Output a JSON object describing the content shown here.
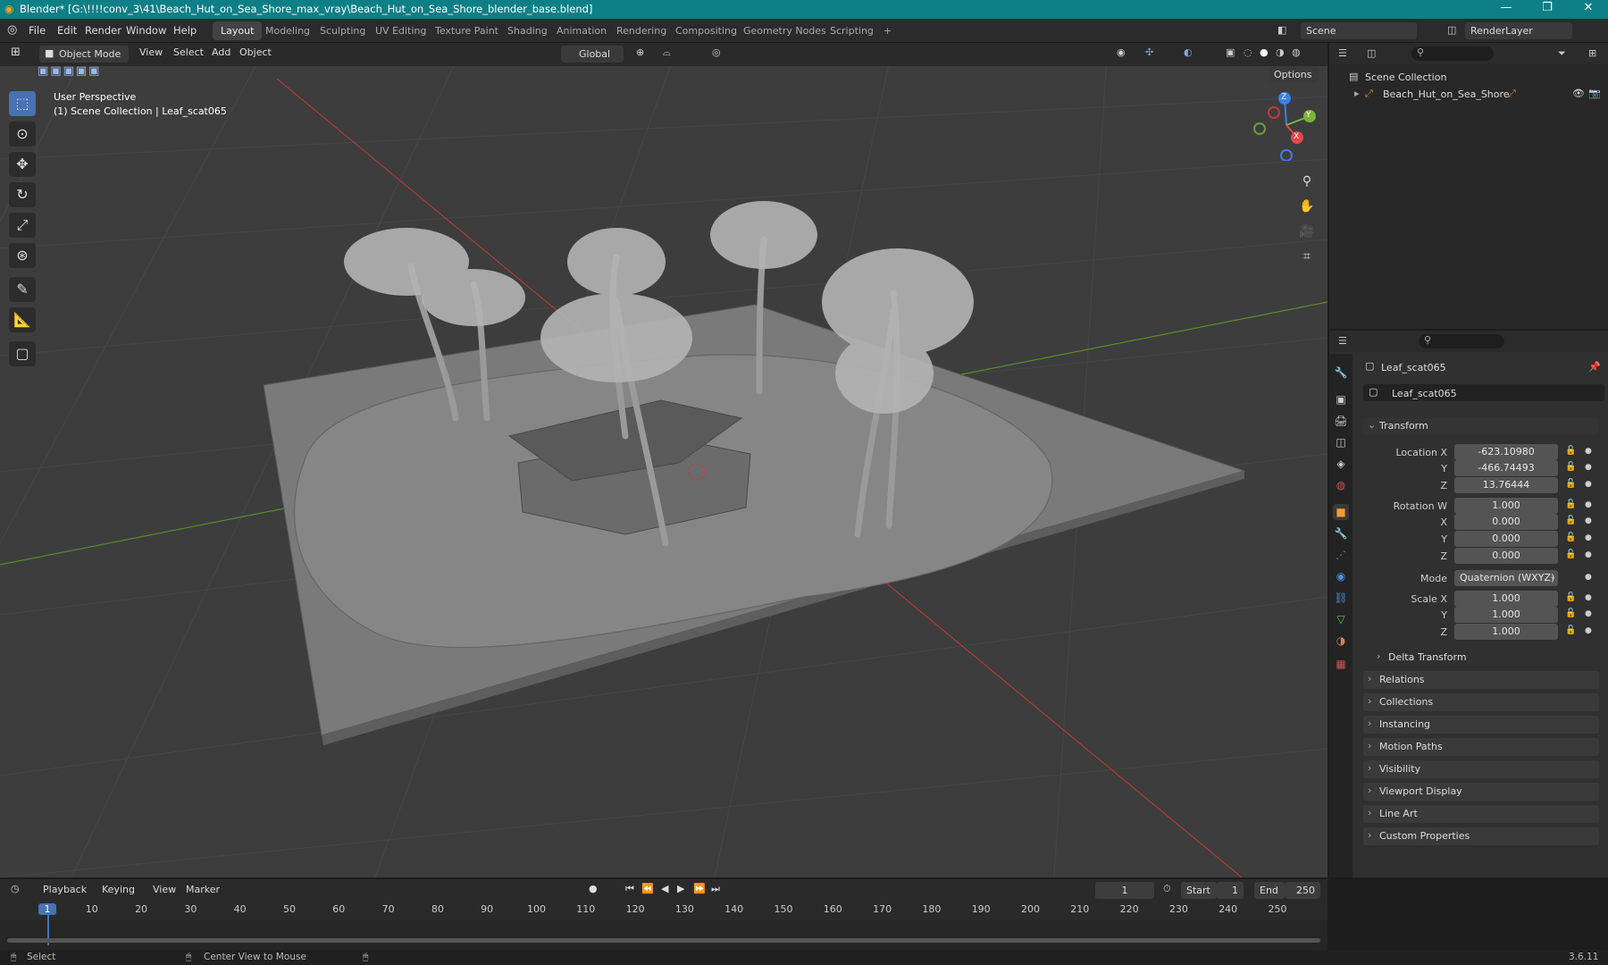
{
  "window": {
    "title": "Blender* [G:\\!!!!conv_3\\41\\Beach_Hut_on_Sea_Shore_max_vray\\Beach_Hut_on_Sea_Shore_blender_base.blend]",
    "minimize": "—",
    "maximize": "❐",
    "close": "✕"
  },
  "menu": [
    "File",
    "Edit",
    "Render",
    "Window",
    "Help"
  ],
  "workspaces": [
    "Layout",
    "Modeling",
    "Sculpting",
    "UV Editing",
    "Texture Paint",
    "Shading",
    "Animation",
    "Rendering",
    "Compositing",
    "Geometry Nodes",
    "Scripting"
  ],
  "workspace_add": "+",
  "active_workspace": "Layout",
  "scene": {
    "name": "Scene",
    "render_layer": "RenderLayer"
  },
  "viewport_header": {
    "mode": "Object Mode",
    "menus": [
      "View",
      "Select",
      "Add",
      "Object"
    ],
    "orientation": "Global",
    "options": "Options"
  },
  "viewport_overlay": {
    "line1": "User Perspective",
    "line2": "(1) Scene Collection | Leaf_scat065"
  },
  "gizmo": {
    "x": "X",
    "y": "Y",
    "z": "Z"
  },
  "outliner": {
    "root": "Scene Collection",
    "item": "Beach_Hut_on_Sea_Shore"
  },
  "properties": {
    "object_name": "Leaf_scat065",
    "datablock": "Leaf_scat065",
    "transform": {
      "header": "Transform",
      "location": {
        "label": "Location X",
        "x": "-623.10980",
        "y": "-466.74493",
        "z": "13.76444"
      },
      "rotation": {
        "label": "Rotation W",
        "w": "1.000",
        "x": "0.000",
        "y": "0.000",
        "z": "0.000"
      },
      "mode_label": "Mode",
      "mode": "Quaternion (WXYZ)",
      "scale": {
        "label": "Scale X",
        "x": "1.000",
        "y": "1.000",
        "z": "1.000"
      },
      "axis_y": "Y",
      "axis_z": "Z",
      "axis_x": "X",
      "delta": "Delta Transform"
    },
    "panels": [
      "Relations",
      "Collections",
      "Instancing",
      "Motion Paths",
      "Visibility",
      "Viewport Display",
      "Line Art",
      "Custom Properties"
    ]
  },
  "timeline": {
    "menus": [
      "Playback",
      "Keying",
      "View",
      "Marker"
    ],
    "current_frame": "1",
    "start_label": "Start",
    "start": "1",
    "end_label": "End",
    "end": "250",
    "ticks": [
      "1",
      "10",
      "20",
      "30",
      "40",
      "50",
      "60",
      "70",
      "80",
      "90",
      "100",
      "110",
      "120",
      "130",
      "140",
      "150",
      "160",
      "170",
      "180",
      "190",
      "200",
      "210",
      "220",
      "230",
      "240",
      "250"
    ]
  },
  "status": {
    "select": "Select",
    "center": "Center View to Mouse",
    "version": "3.6.11"
  },
  "colors": {
    "titlebar": "#0f7f86",
    "active_tool": "#4772b3",
    "x_axis": "#c0393b",
    "y_axis": "#6aa12f"
  }
}
